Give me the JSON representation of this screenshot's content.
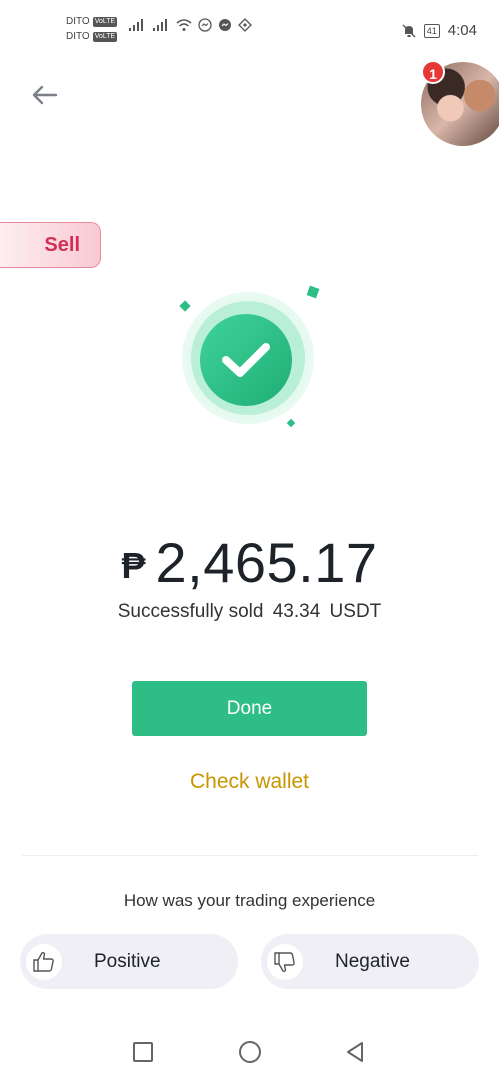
{
  "status_bar": {
    "carrier_1": "DITO",
    "carrier_2": "DITO",
    "volte_label": "VoLTE",
    "battery": "41",
    "time": "4:04"
  },
  "header": {
    "notification_count": "1"
  },
  "tag": {
    "label": "Sell"
  },
  "result": {
    "currency_symbol": "₱",
    "amount": "2,465.17",
    "message": "Successfully sold",
    "quantity": "43.34",
    "asset": "USDT"
  },
  "actions": {
    "done_label": "Done",
    "check_wallet_label": "Check wallet"
  },
  "feedback": {
    "question": "How was your trading experience",
    "positive_label": "Positive",
    "negative_label": "Negative"
  },
  "colors": {
    "success_green": "#2ebd85",
    "wallet_link": "#c99400",
    "sell_red": "#d32f56"
  },
  "icons": {
    "back": "arrow-left-icon",
    "success": "check-circle-icon",
    "positive": "thumbs-up-icon",
    "negative": "thumbs-down-icon"
  }
}
